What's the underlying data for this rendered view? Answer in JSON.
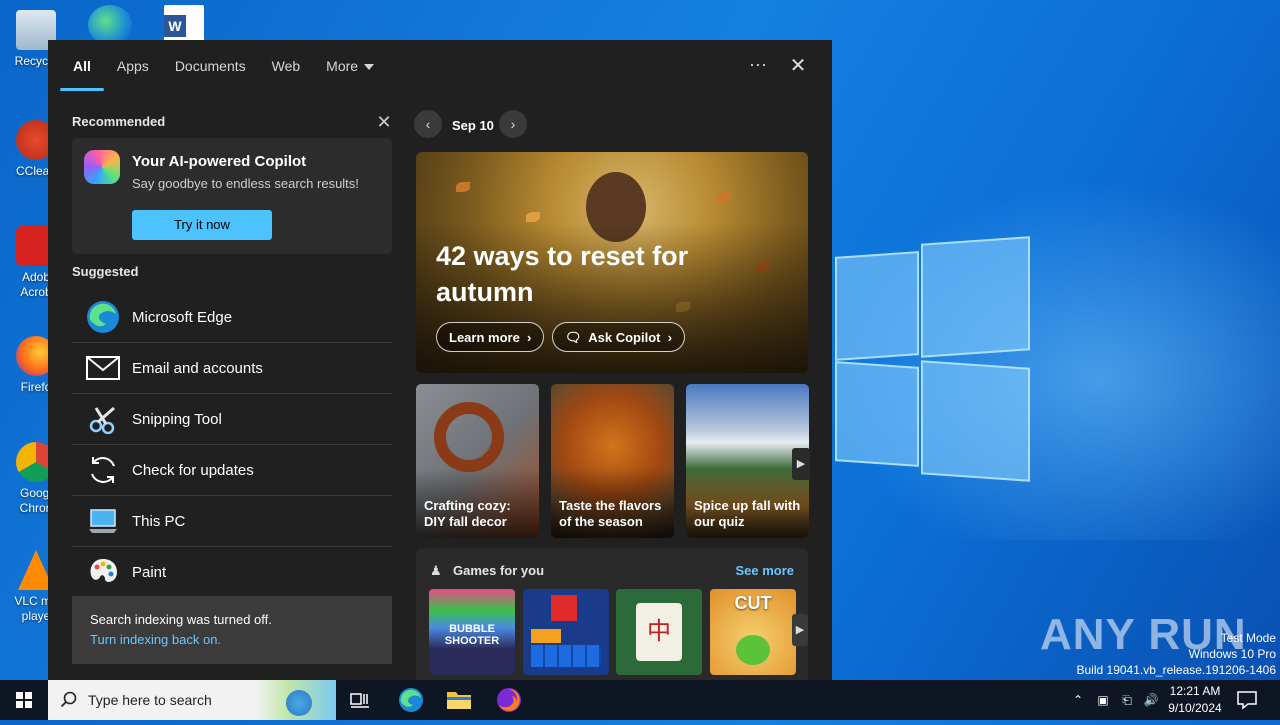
{
  "desktop": {
    "icons": [
      {
        "label": "Recycle",
        "name": "recycle-bin"
      },
      {
        "label": "CClean",
        "name": "ccleaner"
      },
      {
        "label": "Adob Acrob",
        "name": "adobe-acrobat"
      },
      {
        "label": "Firefo",
        "name": "firefox"
      },
      {
        "label": "Googl Chron",
        "name": "google-chrome"
      },
      {
        "label": "VLC me playe",
        "name": "vlc-media-player"
      }
    ],
    "watermark": "ANY RUN",
    "build_line1": "Test Mode",
    "build_line2": "Windows 10 Pro",
    "build_line3": "Build 19041.vb_release.191206-1406"
  },
  "search_panel": {
    "tabs": [
      "All",
      "Apps",
      "Documents",
      "Web",
      "More"
    ],
    "more_menu_glyph": "···",
    "close_glyph": "✕",
    "recommended": {
      "title": "Recommended",
      "card_title": "Your AI-powered Copilot",
      "card_subtitle": "Say goodbye to endless search results!",
      "button": "Try it now"
    },
    "suggested": {
      "title": "Suggested",
      "items": [
        "Microsoft Edge",
        "Email and accounts",
        "Snipping Tool",
        "Check for updates",
        "This PC",
        "Paint"
      ]
    },
    "indexing": {
      "message": "Search indexing was turned off.",
      "link": "Turn indexing back on."
    },
    "highlights": {
      "date": "Sep 10",
      "hero_title": "42 ways to reset for autumn",
      "hero_buttons": [
        "Learn more",
        "Ask Copilot"
      ],
      "cards": [
        "Crafting cozy: DIY fall decor",
        "Taste the flavors of the season",
        "Spice up fall with our quiz"
      ],
      "games_title": "Games for you",
      "see_more": "See more",
      "games": [
        "Bubble Shooter HD",
        "Block puzzle",
        "Mahjong",
        "Cut the Rope"
      ]
    }
  },
  "taskbar": {
    "search_placeholder": "Type here to search",
    "time": "12:21 AM",
    "date": "9/10/2024"
  },
  "colors": {
    "accent": "#4cc2ff",
    "panel_bg": "#202020",
    "link": "#6cc4ff"
  }
}
